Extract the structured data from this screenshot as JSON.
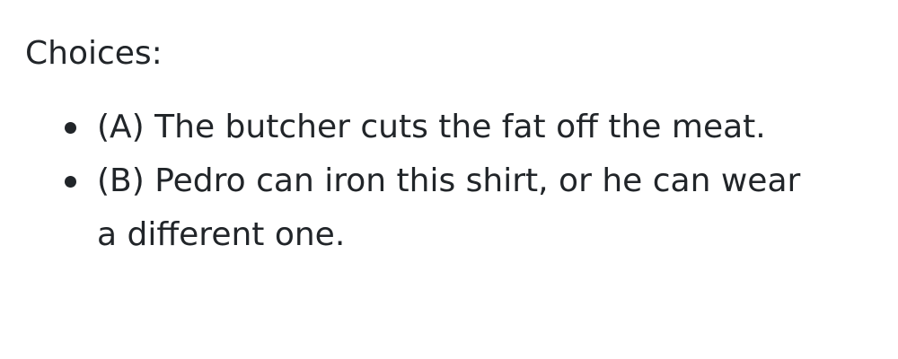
{
  "heading": "Choices:",
  "choices": [
    {
      "text": "(A) The butcher cuts the fat off the meat."
    },
    {
      "text": "(B) Pedro can iron this shirt, or he can wear a different one."
    }
  ]
}
